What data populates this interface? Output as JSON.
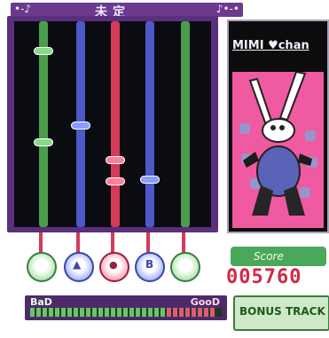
{
  "header": {
    "title": "未定",
    "left_deco": "•-♪",
    "right_deco": "♪•-•"
  },
  "character": {
    "name": "MIMI ♥chan"
  },
  "score": {
    "label": "Score",
    "value": "005760"
  },
  "meter": {
    "bad_label": "BaD",
    "good_label": "GooD"
  },
  "bonus": {
    "label": "BONUS TRACK"
  },
  "lanes": [
    {
      "color": "#4a9d4a"
    },
    {
      "color": "#4c59c9"
    },
    {
      "color": "#d53a5a"
    },
    {
      "color": "#4c59c9"
    },
    {
      "color": "#4a9d4a"
    }
  ],
  "buttons": [
    {
      "name": "green-button-1",
      "glyph": ""
    },
    {
      "name": "blue-button-triangle",
      "glyph": "▲"
    },
    {
      "name": "red-button",
      "glyph": "●"
    },
    {
      "name": "blue-button-b",
      "glyph": "B"
    },
    {
      "name": "green-button-2",
      "glyph": ""
    }
  ]
}
